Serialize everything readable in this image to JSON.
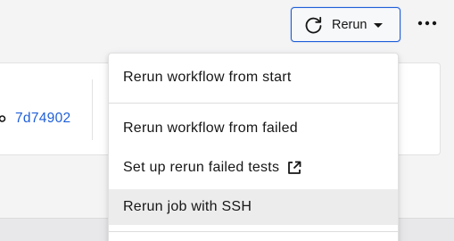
{
  "header": {
    "rerun_button_label": "Rerun",
    "rerun_icon": "refresh-icon",
    "caret_icon": "caret-down-icon",
    "more_icon": "more-horizontal-icon"
  },
  "commit": {
    "icon": "commit-icon",
    "hash": "7d74902"
  },
  "rerun_menu": {
    "items": [
      {
        "label": "Rerun workflow from start"
      },
      {
        "label": "Rerun workflow from failed"
      },
      {
        "label": "Set up rerun failed tests",
        "icon": "external-link-icon"
      },
      {
        "label": "Rerun job with SSH",
        "highlighted": true
      }
    ]
  },
  "colors": {
    "accent": "#1f5fd8",
    "highlight": "#ececec",
    "background": "#f4f4f5"
  }
}
